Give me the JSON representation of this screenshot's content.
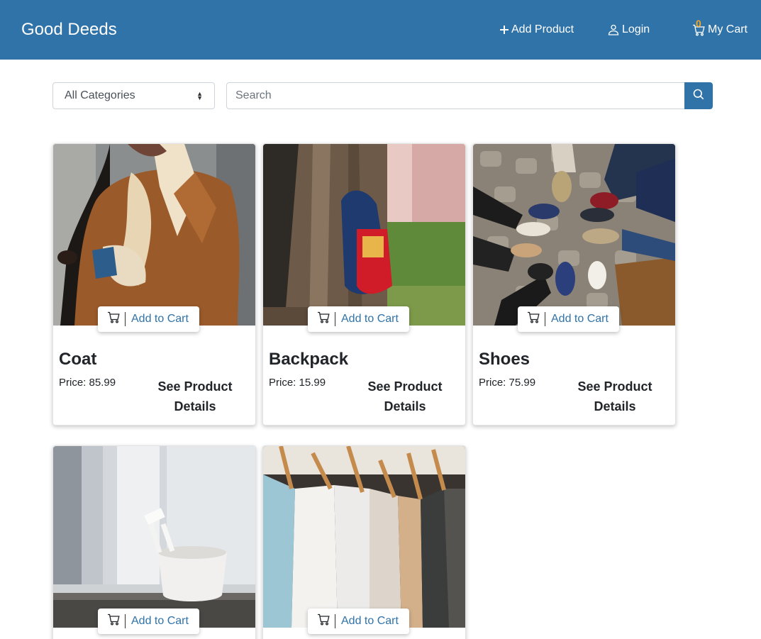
{
  "navbar": {
    "brand": "Good Deeds",
    "add_product": "Add Product",
    "login": "Login",
    "cart_label": "My Cart",
    "cart_count": "0",
    "background": "#3073a9"
  },
  "filters": {
    "category_selected": "All Categories",
    "search_placeholder": "Search"
  },
  "card_labels": {
    "add_to_cart": "Add to Cart",
    "see_details": "See Product Details"
  },
  "products": [
    {
      "name": "Coat",
      "price": "Price: 85.99",
      "image": "woman-in-brown-shearling-coat-photo"
    },
    {
      "name": "Backpack",
      "price": "Price: 15.99",
      "image": "backpack-leaning-on-tree-photo"
    },
    {
      "name": "Shoes",
      "price": "Price: 75.99",
      "image": "feet-in-circle-on-cobblestones-photo"
    },
    {
      "name": "",
      "price": "",
      "image": "white-cup-on-windowsill-photo"
    },
    {
      "name": "",
      "price": "",
      "image": "shirts-on-hangers-photo"
    }
  ],
  "icons": {
    "add_product": "plus-icon",
    "login": "user-icon",
    "cart": "cart-icon",
    "search": "search-icon",
    "select": "chevron-up-down-icon"
  }
}
